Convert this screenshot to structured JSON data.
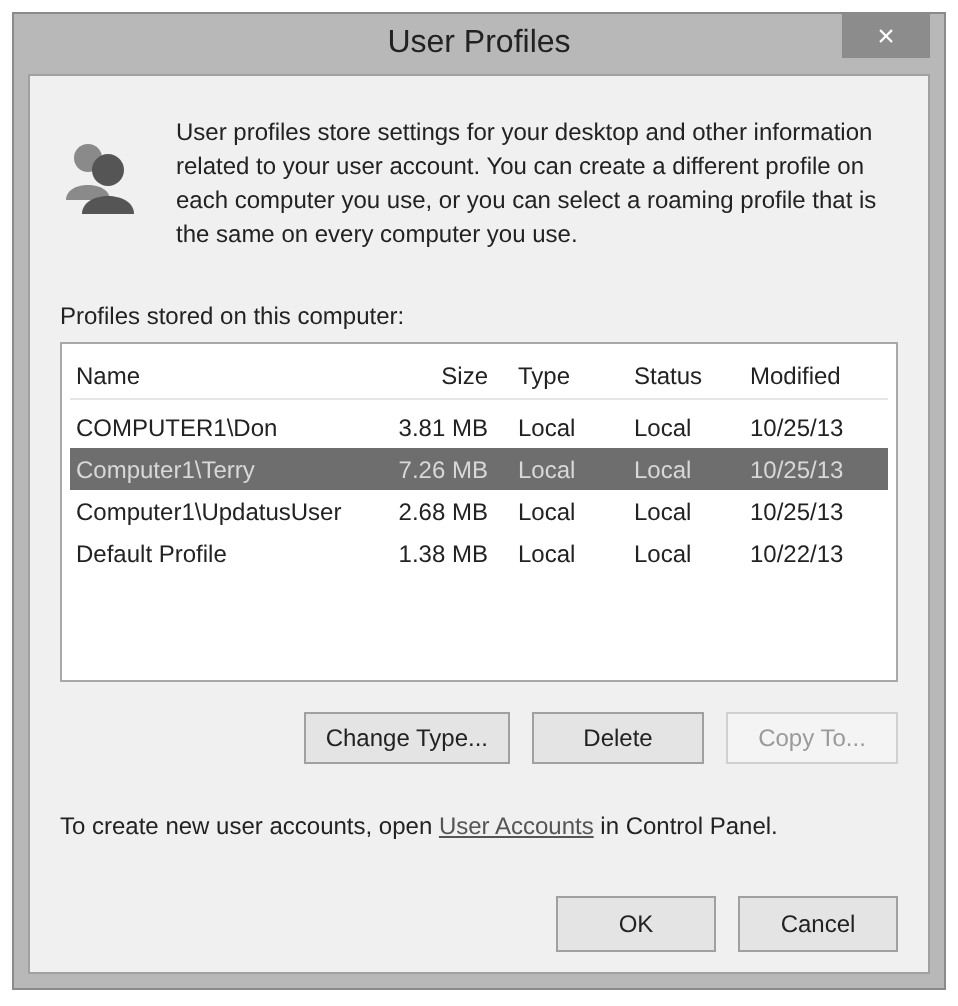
{
  "window": {
    "title": "User Profiles",
    "close": "×"
  },
  "description": "User profiles store settings for your desktop and other information related to your user account. You can create a different profile on each computer you use, or you can select a roaming profile that is the same on every computer you use.",
  "list_label": "Profiles stored on this computer:",
  "table": {
    "columns": [
      "Name",
      "Size",
      "Type",
      "Status",
      "Modified"
    ],
    "rows": [
      {
        "cells": [
          "COMPUTER1\\Don",
          "3.81 MB",
          "Local",
          "Local",
          "10/25/13"
        ],
        "selected": false
      },
      {
        "cells": [
          "Computer1\\Terry",
          "7.26 MB",
          "Local",
          "Local",
          "10/25/13"
        ],
        "selected": true
      },
      {
        "cells": [
          "Computer1\\UpdatusUser",
          "2.68 MB",
          "Local",
          "Local",
          "10/25/13"
        ],
        "selected": false
      },
      {
        "cells": [
          "Default Profile",
          "1.38 MB",
          "Local",
          "Local",
          "10/22/13"
        ],
        "selected": false
      }
    ]
  },
  "actions": [
    {
      "label": "Change Type...",
      "disabled": false
    },
    {
      "label": "Delete",
      "disabled": false
    },
    {
      "label": "Copy To...",
      "disabled": true
    }
  ],
  "footer": {
    "before": "To create new user accounts, open ",
    "link": "User Accounts",
    "after": " in Control Panel."
  },
  "buttons": [
    "OK",
    "Cancel"
  ]
}
